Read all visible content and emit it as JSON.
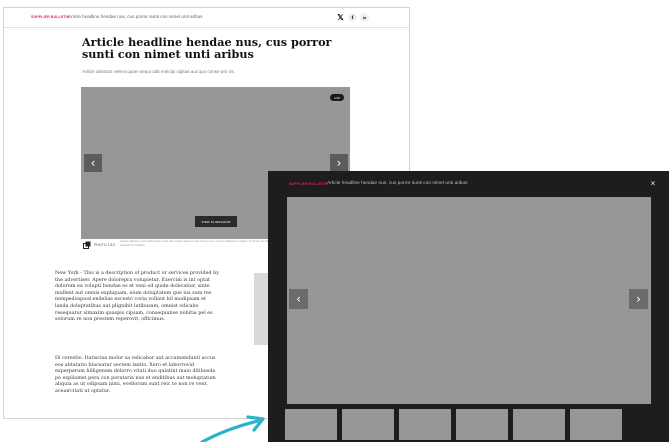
{
  "colors": {
    "brand_accent": "#e8185a",
    "placeholder_gray": "#979797",
    "modal_bg": "#1d1d1d",
    "arrow_color": "#2bb3c9"
  },
  "article": {
    "topbar": {
      "supplier_label": "SUPPLIER BULLETIN",
      "title": "Article headline hendae nus, cus porror sunti con nimet unti aribus",
      "social": [
        {
          "icon": "x-icon",
          "glyph": "𝕏"
        },
        {
          "icon": "facebook-icon",
          "glyph": "f"
        },
        {
          "icon": "linkedin-icon",
          "glyph": "in"
        }
      ]
    },
    "headline": "Article headline hendae nus, cus porror sunti con nimet unti aribus",
    "abstract": "Article abstract velent quam sequi odit mincipi cipitas aut quo conse pro int.",
    "hero": {
      "badge": "1/10",
      "prev_icon": "chevron-left-icon",
      "next_icon": "chevron-right-icon",
      "button_label": "VIEW SLIDESHOW"
    },
    "photo_count": "PHOTO 1/10",
    "caption": "Caption elibeaCe ecrit velabri quam sequi odit mincipi cipitas aut quo conse pro int, vel quo ilitalsentem modern. Or pit aim qui doloprat, modi voloreptas pererpta quaspiet, quam non et non con poinr intenedr min mintibus",
    "paragraphs": [
      "New York - This is a description of product or services provided by the advertiser. Apere dolorepra volupietur. Exercim is int optat dolorum ea volupti hendae es et veni od quide dolecatiur, sinte mullent aut omnis expliquam, eium doluptatem que ius sum res nempedisquod endelias excesto coria vollaut hil modipsam et landa doluptatibus aut plignibit latibusam, omnist odicabo resequatur simaxim quaspis cipsam, consequunse nobitia pel es solorum re non prestem reperovit, officimus.",
      "Di corestio. Itatiscius molor sa velicabor aut accumendunti accus eos alitatatio blaceatur sectem lantio. Xero et laborrovid experperum hilligenem dolorro vitati duo quiatint maio ditibusda pe expliamet pera con porataria nus et enditibus aut moluptatum aliquia as ut odipsam nimi, evellorum sunt reic te non re vent, aceaircitati ut optatur."
    ]
  },
  "modal": {
    "supplier_label": "SUPPLIER BULLETIN",
    "title": "Article headline hendae nus, cus porror sunti con nimet unti aribus",
    "close_glyph": "×",
    "prev_glyph": "‹",
    "next_glyph": "›",
    "thumbnails": [
      {
        "label": "thumbnail-1"
      },
      {
        "label": "thumbnail-2"
      },
      {
        "label": "thumbnail-3"
      },
      {
        "label": "thumbnail-4"
      },
      {
        "label": "thumbnail-5"
      },
      {
        "label": "thumbnail-6"
      }
    ]
  }
}
